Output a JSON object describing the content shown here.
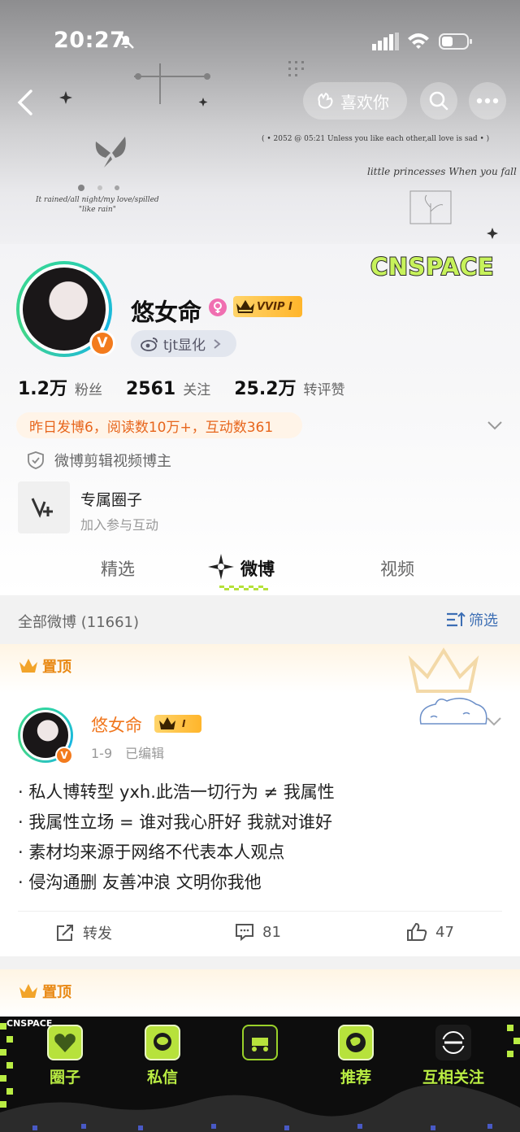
{
  "status_bar": {
    "time": "20:27"
  },
  "nav": {
    "like_label": "喜欢你"
  },
  "banner": {
    "quote_line": "( • 2052 @ 05:21 Unless you like each other,all love is sad • )",
    "script_line": "little princesses  When you fall in",
    "poem_line1": "It rained/all night/my love/spilled",
    "poem_line2": "\"like rain\"",
    "logo_text": "CNSPACE"
  },
  "profile": {
    "name": "悠女命",
    "vip_label": "VVIP Ⅰ",
    "verified_mark": "V",
    "weibo_chip": "tjt显化",
    "stats": [
      {
        "value": "1.2万",
        "label": "粉丝"
      },
      {
        "value": "2561",
        "label": "关注"
      },
      {
        "value": "25.2万",
        "label": "转评赞"
      }
    ],
    "daily_summary": "昨日发博6，阅读数10万+，互动数361",
    "certification": "微博剪辑视频博主",
    "circle_title": "专属圈子",
    "circle_subtitle": "加入参与互动"
  },
  "tabs": [
    "精选",
    "微博",
    "视频"
  ],
  "filter": {
    "label": "全部微博 (11661)",
    "button": "筛选"
  },
  "pinned_label": "置顶",
  "post": {
    "author": "悠女命",
    "vip_label": "Ⅰ",
    "date": "1-9",
    "edited": "已编辑",
    "lines": [
      "· 私人博转型 yxh.此浩一切行为 ≠ 我属性",
      "· 我属性立场 = 谁对我心肝好 我就对谁好",
      "· 素材均来源于网络不代表本人观点",
      "· 侵沟通删 友善冲浪 文明你我他"
    ],
    "repost_label": "转发",
    "comment_count": "81",
    "like_count": "47"
  },
  "bottom_nav": {
    "top_logo": "CNSPACE",
    "items": [
      "圈子",
      "私信",
      "",
      "推荐",
      "互相关注"
    ]
  },
  "colors": {
    "accent_orange": "#f0761d",
    "link_blue": "#3c6eb4",
    "lime": "#b9ec43"
  }
}
